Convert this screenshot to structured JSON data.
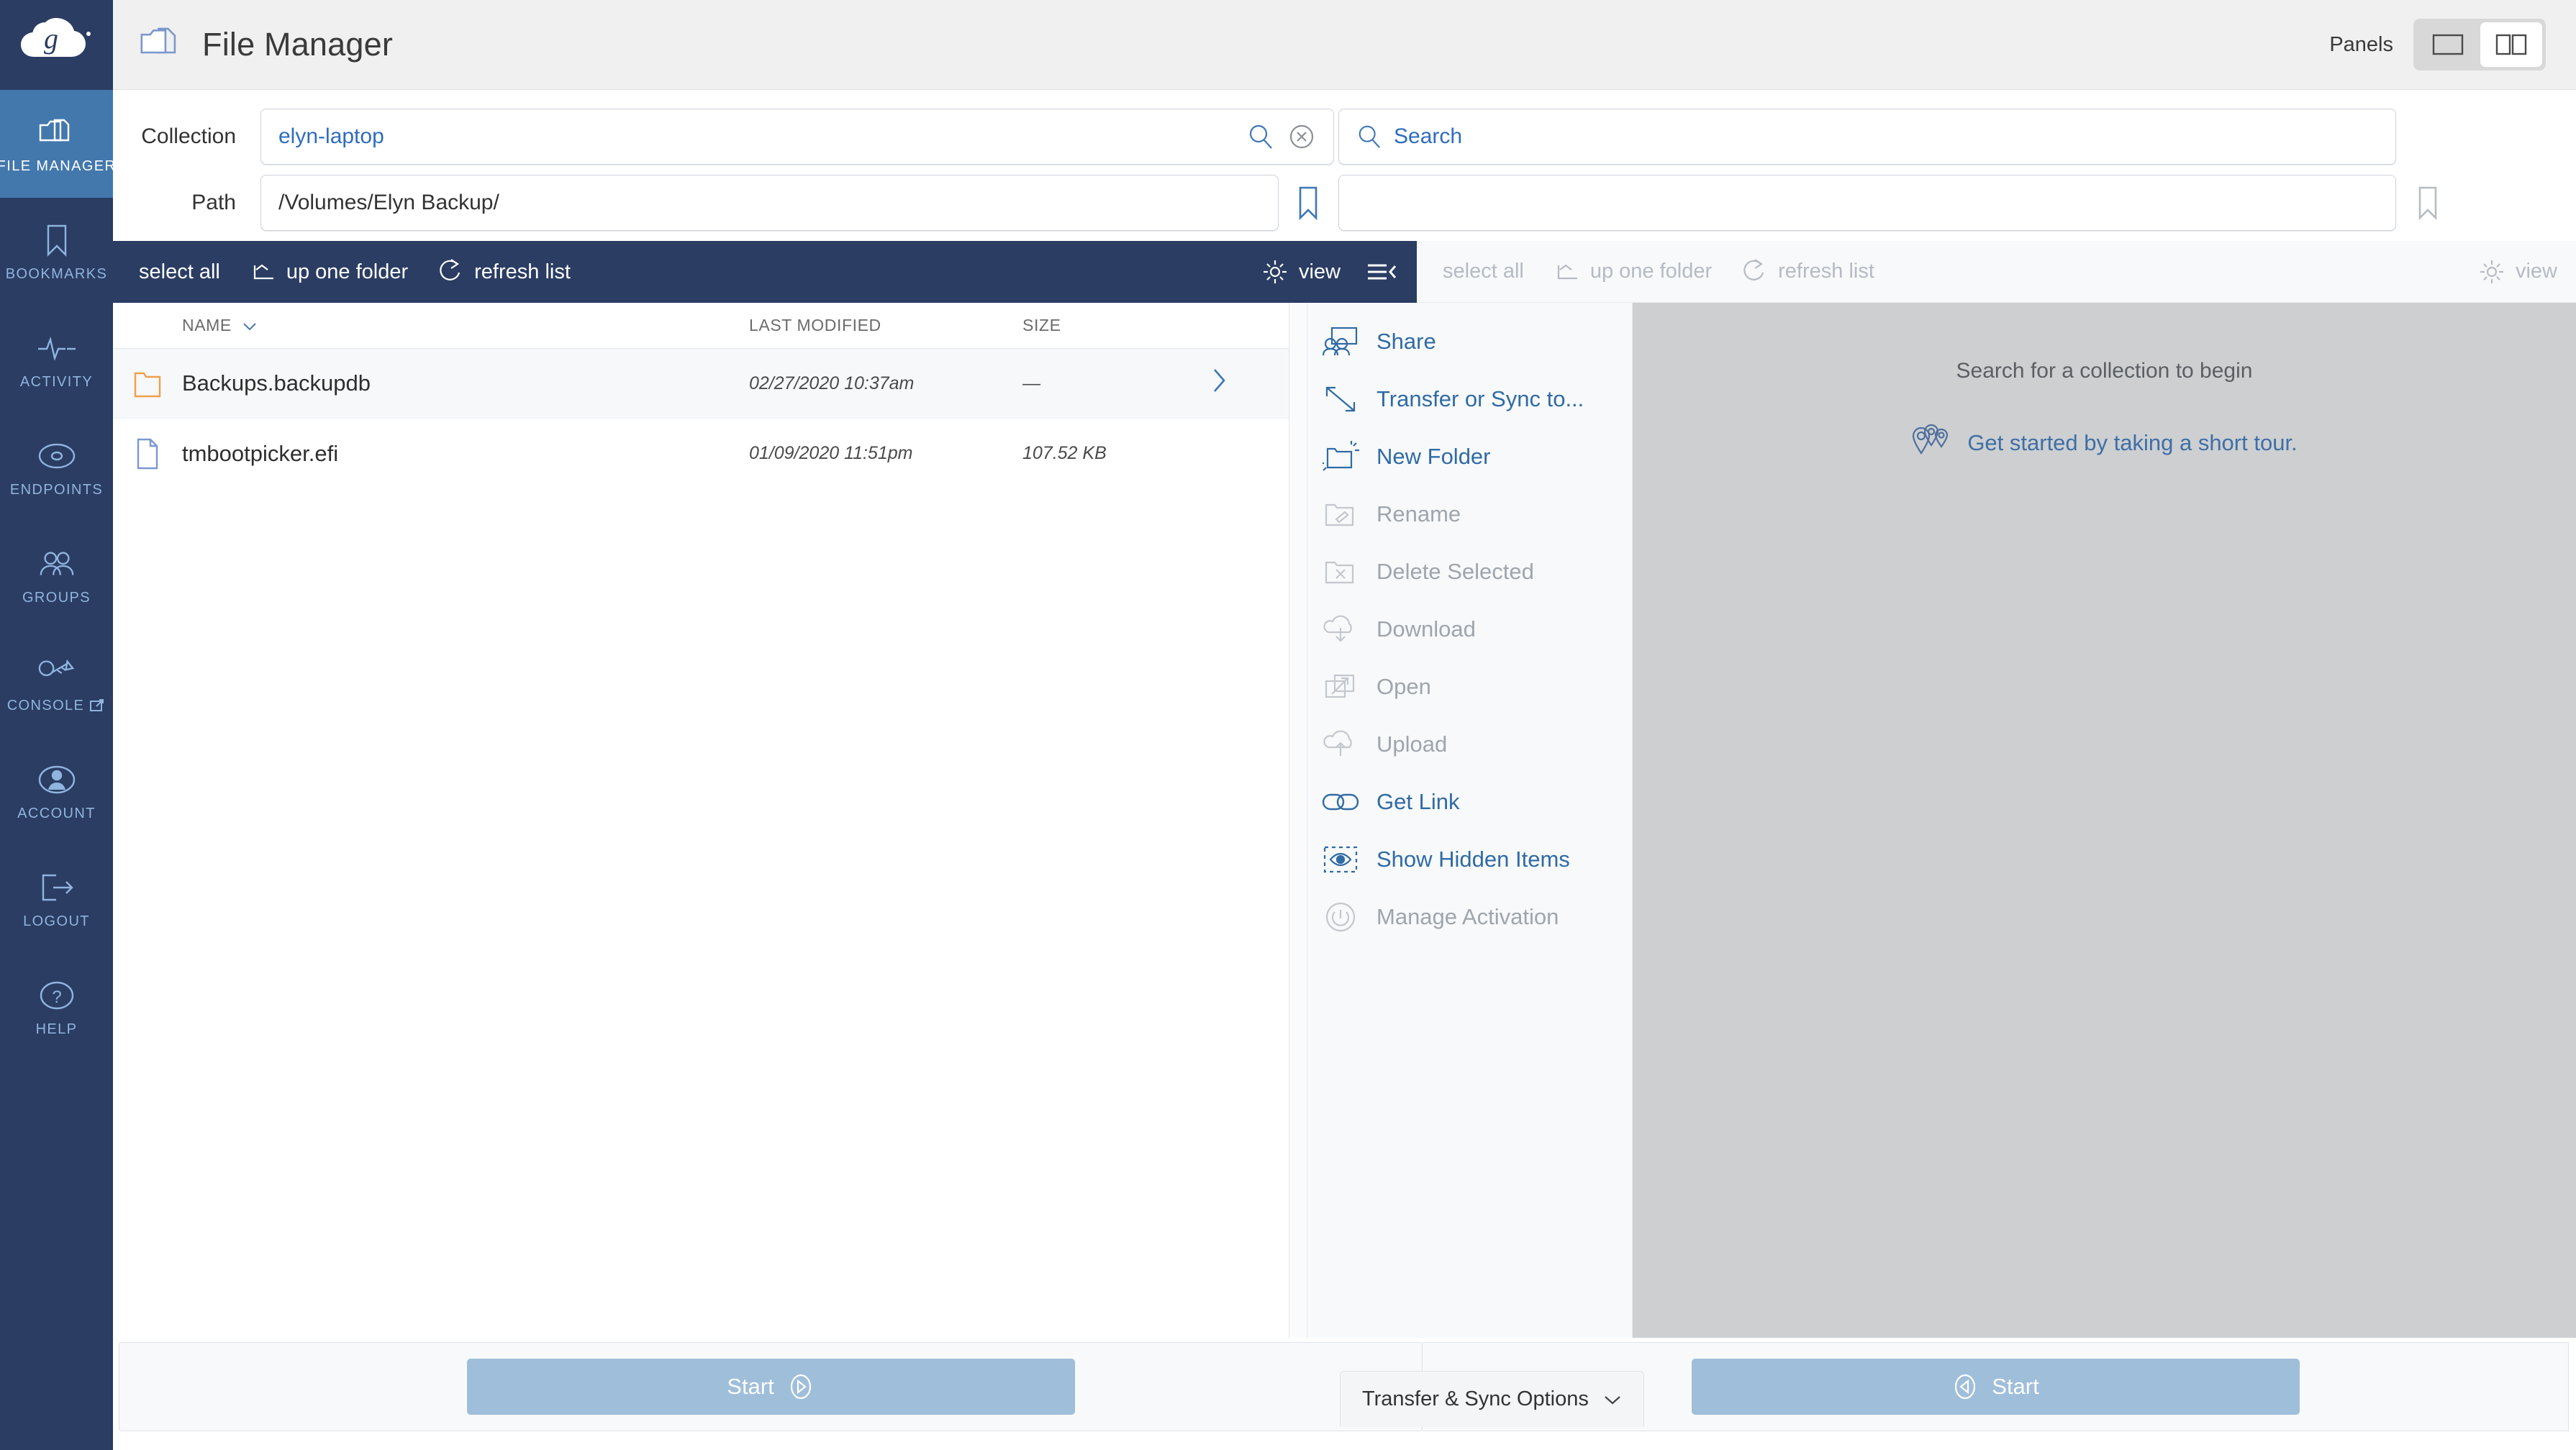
{
  "sidebar": {
    "logo": "g-cloud-logo",
    "items": [
      {
        "label": "FILE MANAGER",
        "icon": "folders-icon",
        "active": true
      },
      {
        "label": "BOOKMARKS",
        "icon": "bookmark-icon",
        "active": false
      },
      {
        "label": "ACTIVITY",
        "icon": "pulse-icon",
        "active": false
      },
      {
        "label": "ENDPOINTS",
        "icon": "disc-icon",
        "active": false
      },
      {
        "label": "GROUPS",
        "icon": "people-icon",
        "active": false
      },
      {
        "label": "CONSOLE",
        "icon": "key-icon",
        "active": false,
        "external": true
      },
      {
        "label": "ACCOUNT",
        "icon": "user-circle-icon",
        "active": false
      },
      {
        "label": "LOGOUT",
        "icon": "logout-arrow-icon",
        "active": false
      },
      {
        "label": "HELP",
        "icon": "question-circle-icon",
        "active": false
      }
    ]
  },
  "topbar": {
    "title": "File Manager",
    "title_icon": "folders-icon",
    "panels_label": "Panels",
    "panels_single_icon": "single-panel-icon",
    "panels_double_icon": "double-panel-icon",
    "panels_selected": "double"
  },
  "left_panel": {
    "collection_label": "Collection",
    "collection_value": "elyn-laptop",
    "collection_search_icon": "search-icon",
    "collection_clear_icon": "clear-circle-icon",
    "path_label": "Path",
    "path_value": "/Volumes/Elyn Backup/",
    "bookmark_icon": "bookmark-icon",
    "toolbar": {
      "select_all": "select all",
      "up_one_folder": "up one folder",
      "refresh_list": "refresh list",
      "view": "view",
      "collapse_icon": "hamburger-collapse-icon",
      "up_icon": "up-arrow-icon",
      "refresh_icon": "refresh-icon",
      "gear_icon": "gear-icon"
    },
    "columns": [
      "NAME",
      "LAST MODIFIED",
      "SIZE"
    ],
    "sort_icon": "chevron-down-icon",
    "rows": [
      {
        "icon": "folder-icon",
        "name": "Backups.backupdb",
        "modified": "02/27/2020 10:37am",
        "size": "—",
        "chevron": "chevron-right-icon",
        "selected": true
      },
      {
        "icon": "file-icon",
        "name": "tmbootpicker.efi",
        "modified": "01/09/2020 11:51pm",
        "size": "107.52 KB",
        "chevron": "",
        "selected": false
      }
    ],
    "start_label": "Start",
    "start_icon": "play-right-icon"
  },
  "actions": [
    {
      "label": "Share",
      "icon": "share-people-icon",
      "disabled": false
    },
    {
      "label": "Transfer or Sync to...",
      "icon": "transfer-arrow-icon",
      "disabled": false
    },
    {
      "label": "New Folder",
      "icon": "new-folder-icon",
      "disabled": false
    },
    {
      "label": "Rename",
      "icon": "rename-folder-icon",
      "disabled": true
    },
    {
      "label": "Delete Selected",
      "icon": "delete-folder-icon",
      "disabled": true
    },
    {
      "label": "Download",
      "icon": "cloud-download-icon",
      "disabled": true
    },
    {
      "label": "Open",
      "icon": "open-external-icon",
      "disabled": true
    },
    {
      "label": "Upload",
      "icon": "cloud-upload-icon",
      "disabled": true
    },
    {
      "label": "Get Link",
      "icon": "link-chain-icon",
      "disabled": false
    },
    {
      "label": "Show Hidden Items",
      "icon": "eye-dashed-icon",
      "disabled": false
    },
    {
      "label": "Manage Activation",
      "icon": "power-icon",
      "disabled": true
    }
  ],
  "right_panel": {
    "search_placeholder": "Search",
    "search_icon": "search-icon",
    "search_value": "",
    "second_field_value": "",
    "bookmark_icon": "bookmark-icon",
    "toolbar": {
      "select_all": "select all",
      "up_one_folder": "up one folder",
      "refresh_list": "refresh list",
      "view": "view",
      "up_icon": "up-arrow-icon",
      "refresh_icon": "refresh-icon",
      "gear_icon": "gear-icon"
    },
    "empty_title": "Search for a collection to begin",
    "tour_text": "Get started by taking a short tour.",
    "tour_icon": "map-pins-icon",
    "start_label": "Start",
    "start_icon": "play-left-icon"
  },
  "transfer_sync": {
    "label": "Transfer & Sync Options",
    "chevron_icon": "chevron-down-icon"
  },
  "colors": {
    "navy": "#2b3d63",
    "nav_active": "#4378ad",
    "link_blue": "#2f6ba5",
    "start_blue": "#9fbeda",
    "folder_orange": "#f0a martial"
  }
}
